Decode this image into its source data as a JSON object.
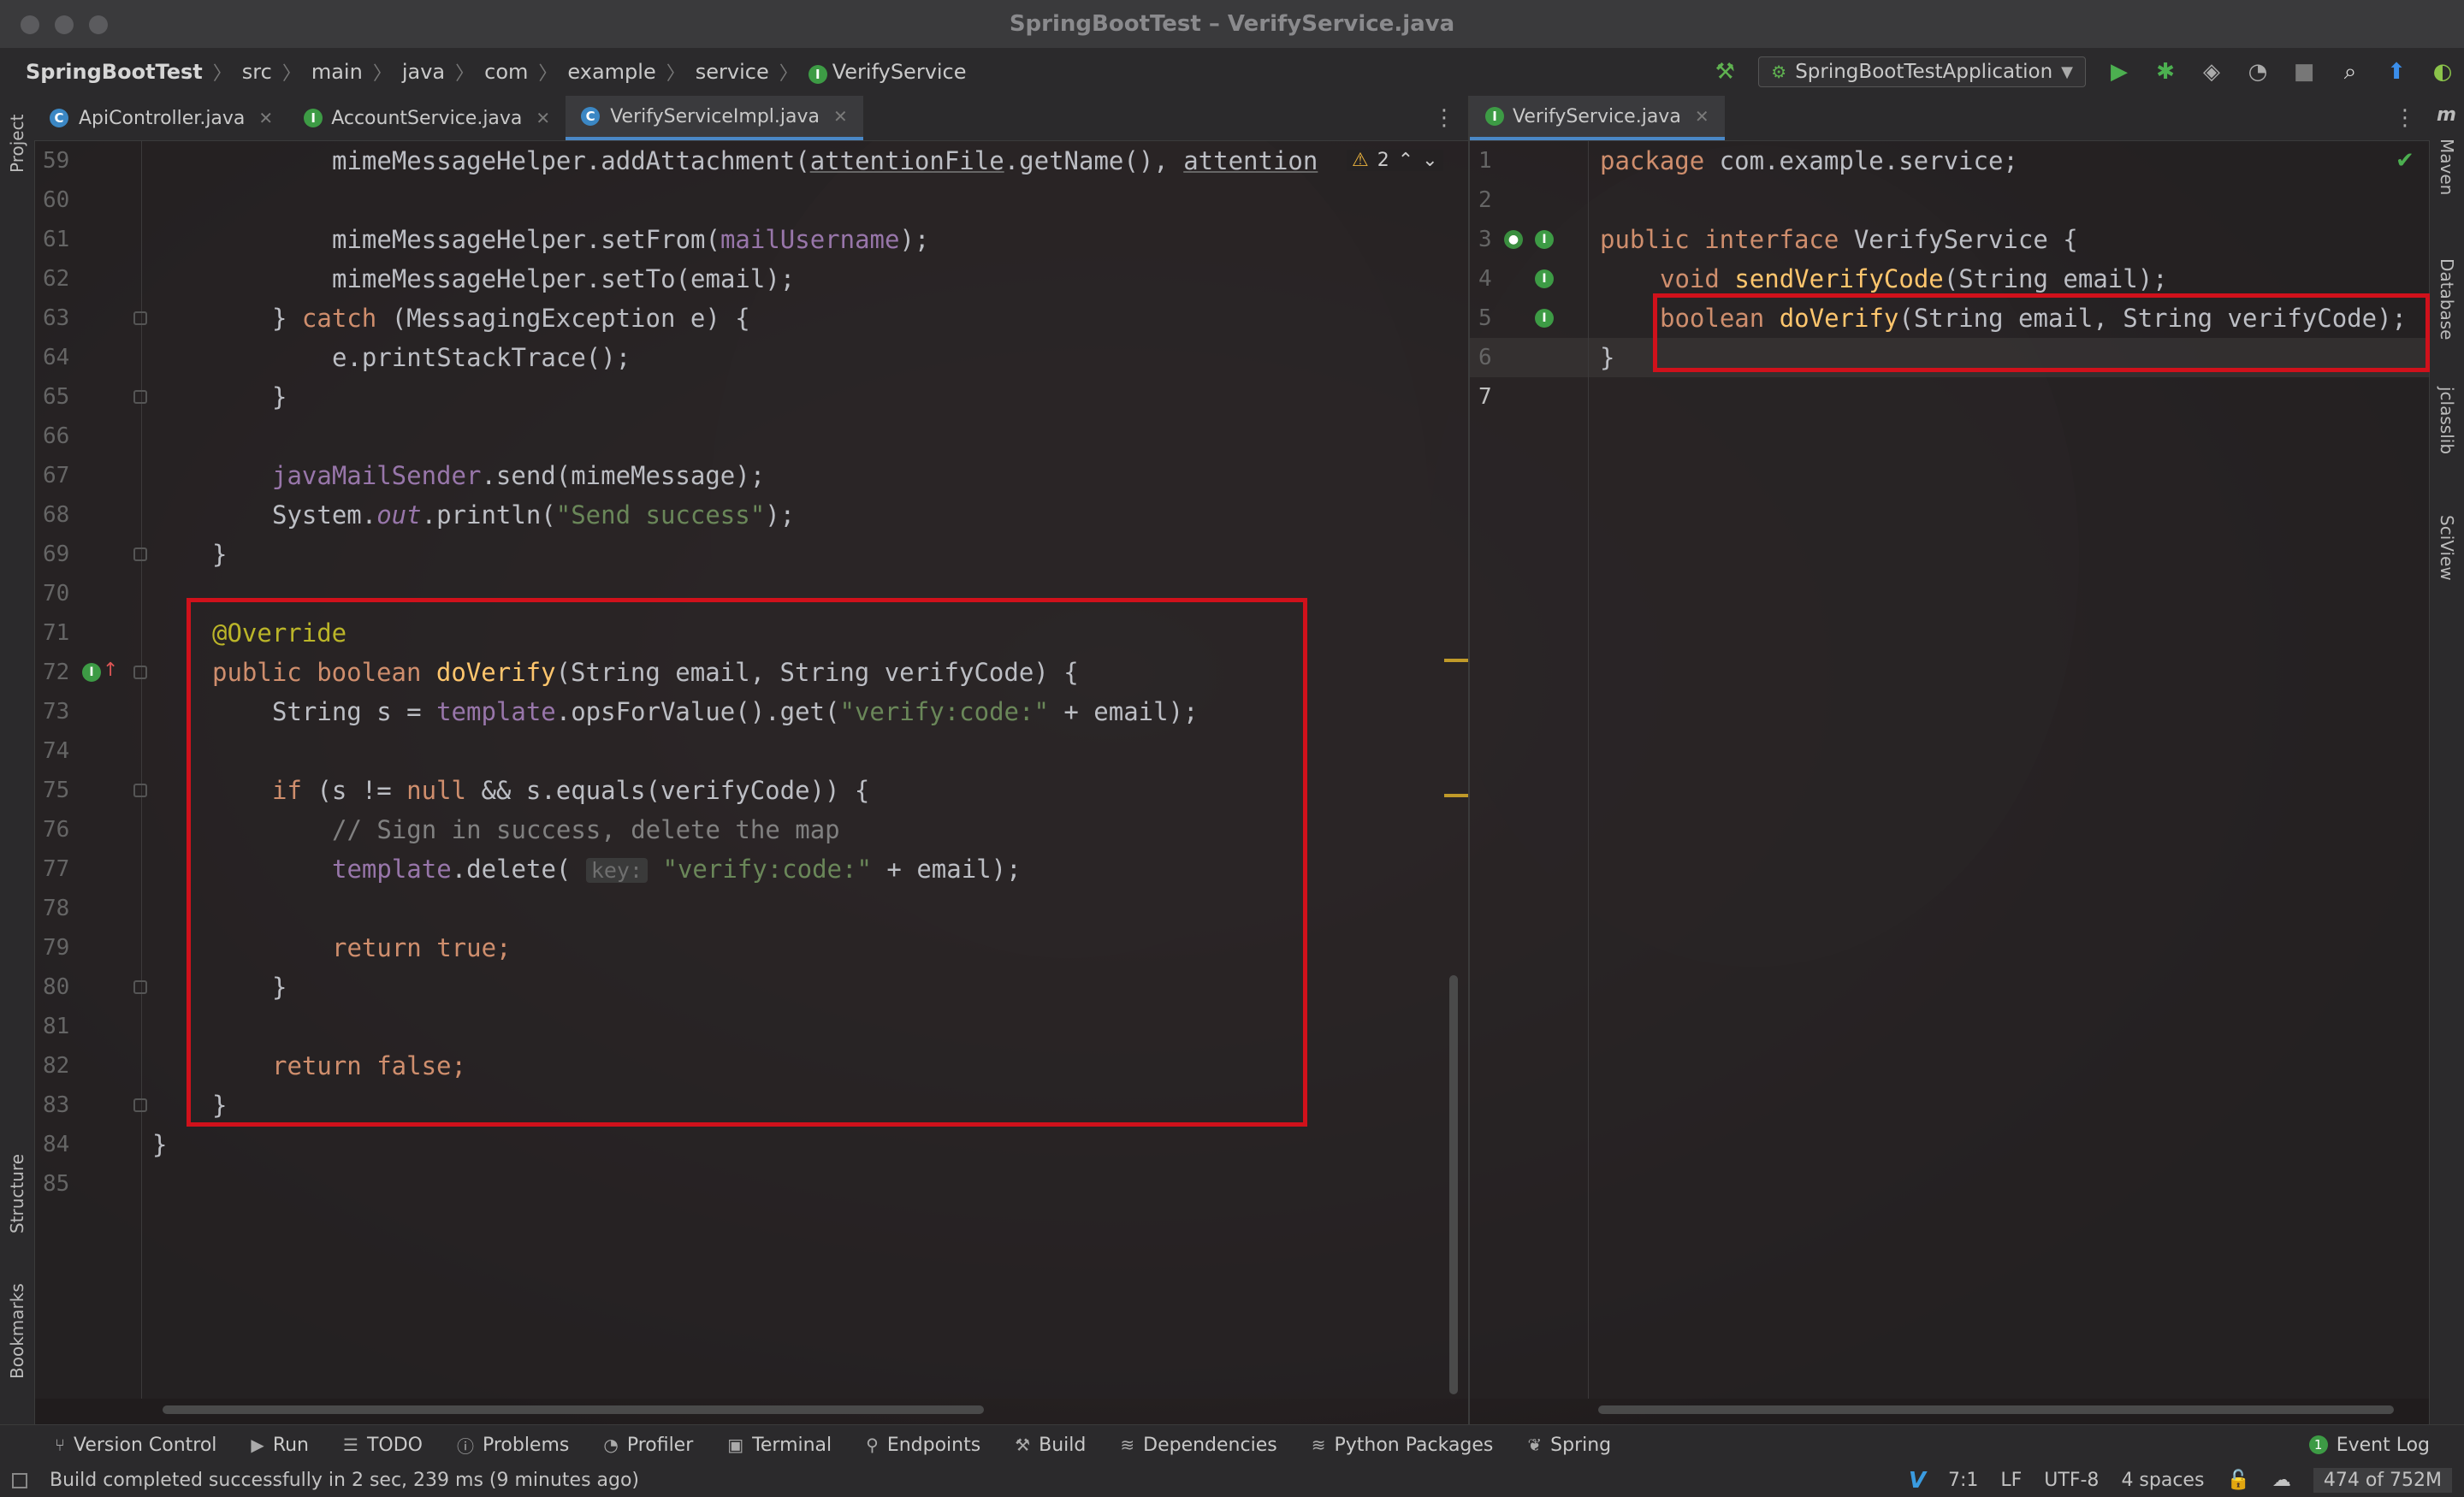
{
  "window": {
    "title": "SpringBootTest – VerifyService.java"
  },
  "navbar": {
    "breadcrumbs": [
      "SpringBootTest",
      "src",
      "main",
      "java",
      "com",
      "example",
      "service",
      "VerifyService"
    ],
    "run_config": "SpringBootTestApplication"
  },
  "left_tabs": [
    {
      "label": "ApiController.java",
      "kind": "C"
    },
    {
      "label": "AccountService.java",
      "kind": "I"
    },
    {
      "label": "VerifyServiceImpl.java",
      "kind": "C"
    }
  ],
  "right_tabs": [
    {
      "label": "VerifyService.java",
      "kind": "I"
    }
  ],
  "left_sidebar": {
    "project": "Project",
    "structure": "Structure",
    "bookmarks": "Bookmarks"
  },
  "right_sidebar": {
    "maven": "Maven",
    "database": "Database",
    "jclasslib": "jclasslib",
    "sciview": "SciView"
  },
  "editor_left": {
    "line_numbers": [
      "59",
      "60",
      "61",
      "62",
      "63",
      "64",
      "65",
      "66",
      "67",
      "68",
      "69",
      "70",
      "71",
      "72",
      "73",
      "74",
      "75",
      "76",
      "77",
      "78",
      "79",
      "80",
      "81",
      "82",
      "83",
      "84",
      "85"
    ],
    "warning_count": "2",
    "lines": {
      "l59_a": "mimeMessageHelper.addAttachment(",
      "l59_b": "attentionFile",
      "l59_c": ".getName(), ",
      "l59_d": "attention",
      "l61_a": "mimeMessageHelper.setFrom(",
      "l61_b": "mailUsername",
      "l61_c": ");",
      "l62": "mimeMessageHelper.setTo(email);",
      "l63_a": "} ",
      "l63_b": "catch",
      "l63_c": " (MessagingException e) {",
      "l64": "e.printStackTrace();",
      "l65": "}",
      "l67_a": "javaMailSender",
      "l67_b": ".send(mimeMessage);",
      "l68_a": "System.",
      "l68_b": "out",
      "l68_c": ".println(",
      "l68_d": "\"Send success\"",
      "l68_e": ");",
      "l69": "}",
      "l71": "@Override",
      "l72_a": "public boolean ",
      "l72_b": "doVerify",
      "l72_c": "(String email, String verifyCode) {",
      "l73_a": "String s = ",
      "l73_b": "template",
      "l73_c": ".opsForValue().get(",
      "l73_d": "\"verify:code:\"",
      "l73_e": " + email);",
      "l75_a": "if",
      "l75_b": " (s != ",
      "l75_c": "null",
      "l75_d": " && s.equals(verifyCode)) {",
      "l76": "// Sign in success, delete the map",
      "l77_a": "template",
      "l77_b": ".delete( ",
      "l77_hint": "key:",
      "l77_c": " \"verify:code:\"",
      "l77_d": " + email);",
      "l79": "return true;",
      "l80": "}",
      "l82": "return false;",
      "l83": "}",
      "l84": "}"
    }
  },
  "editor_right": {
    "line_numbers": [
      "1",
      "2",
      "3",
      "4",
      "5",
      "6",
      "7"
    ],
    "lines": {
      "l1_a": "package",
      "l1_b": " com.example.service;",
      "l3_a": "public interface",
      "l3_b": " VerifyService {",
      "l4_a": "void ",
      "l4_b": "sendVerifyCode",
      "l4_c": "(String email);",
      "l5_a": "boolean ",
      "l5_b": "doVerify",
      "l5_c": "(String email, String verifyCode);",
      "l6": "}"
    }
  },
  "tool_windows": [
    "Version Control",
    "Run",
    "TODO",
    "Problems",
    "Profiler",
    "Terminal",
    "Endpoints",
    "Build",
    "Dependencies",
    "Python Packages",
    "Spring"
  ],
  "event_log": {
    "count": "1",
    "label": "Event Log"
  },
  "status": {
    "message": "Build completed successfully in 2 sec, 239 ms (9 minutes ago)",
    "position": "7:1",
    "line_sep": "LF",
    "encoding": "UTF-8",
    "indent": "4 spaces",
    "memory": "474 of 752M"
  },
  "colors": {
    "highlight_box": "#d0111b",
    "keyword": "#cf8e6d",
    "function": "#ffc66d",
    "string": "#6a8759"
  }
}
